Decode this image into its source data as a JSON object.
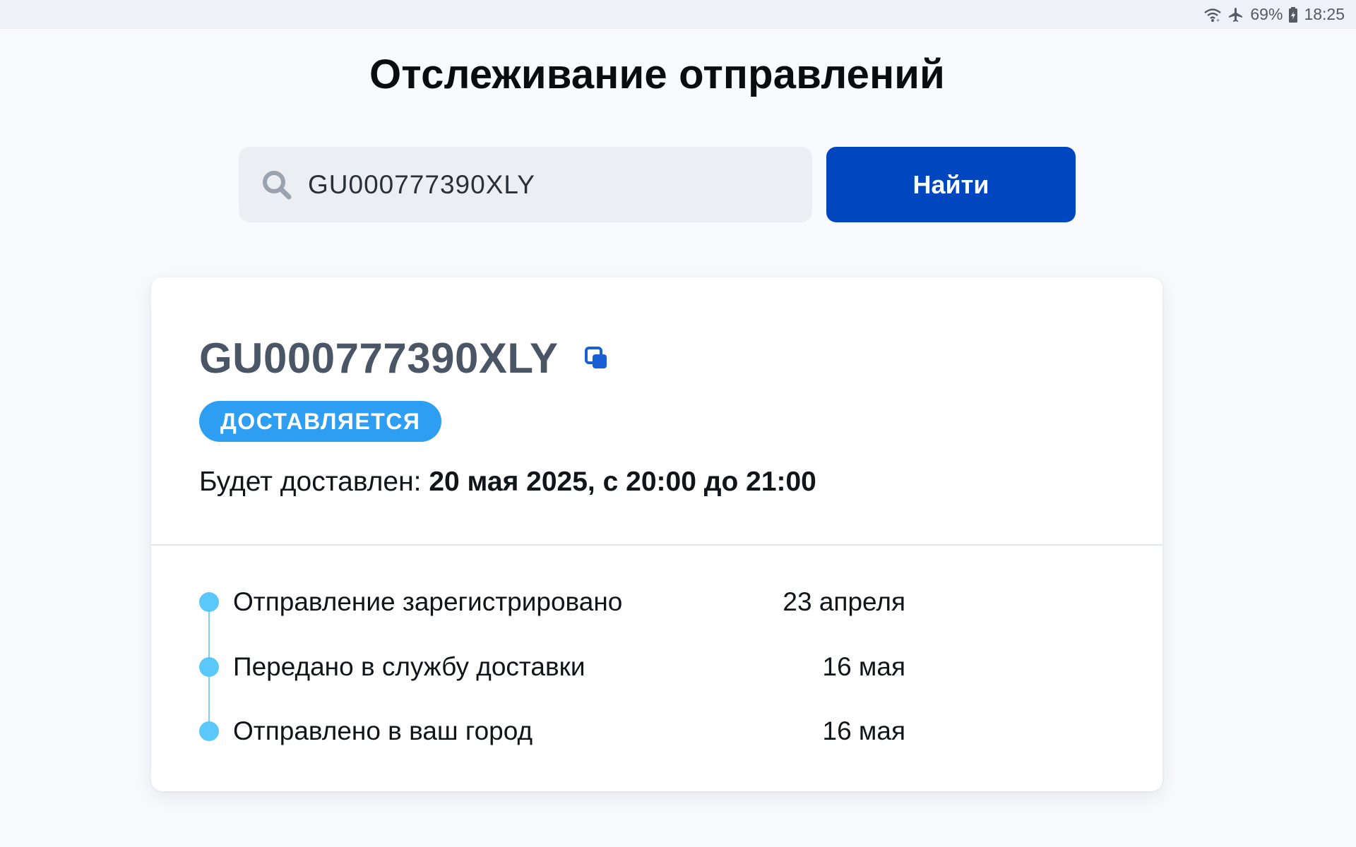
{
  "status_bar": {
    "battery": "69%",
    "time": "18:25",
    "icons": [
      "wifi-icon",
      "airplane-mode-icon",
      "battery-icon"
    ]
  },
  "page": {
    "title": "Отслеживание отправлений"
  },
  "search": {
    "value": "GU000777390XLY",
    "icon": "search-icon",
    "button_label": "Найти"
  },
  "shipment": {
    "tracking_number": "GU000777390XLY",
    "copy_icon": "copy-icon",
    "status": "ДОСТАВЛЯЕТСЯ",
    "eta_label": "Будет доставлен: ",
    "eta_value": "20 мая 2025, с 20:00 до 21:00",
    "events": [
      {
        "text": "Отправление зарегистрировано",
        "date": "23 апреля"
      },
      {
        "text": "Передано в службу доставки",
        "date": "16 мая"
      },
      {
        "text": "Отправлено в ваш город",
        "date": "16 мая"
      }
    ]
  },
  "colors": {
    "accent": "#0047bf",
    "badge": "#2e9ef2",
    "timeline": "#5ac8fa",
    "background": "#f8fafd"
  }
}
